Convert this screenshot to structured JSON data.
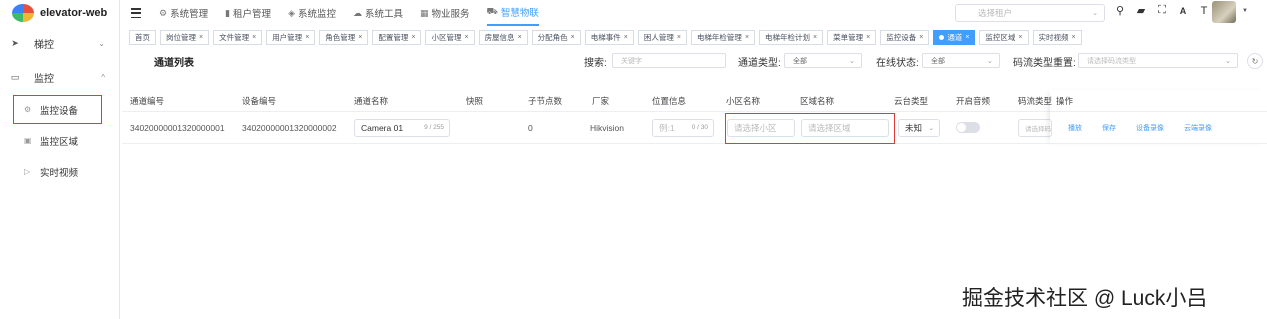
{
  "app": {
    "name": "elevator-web"
  },
  "sidebar": {
    "groups": [
      {
        "label": "梯控",
        "icon": "send-icon",
        "expanded": false
      },
      {
        "label": "监控",
        "icon": "camera-icon",
        "expanded": true,
        "items": [
          {
            "label": "监控设备",
            "icon": "device-icon",
            "active": true
          },
          {
            "label": "监控区域",
            "icon": "area-icon"
          },
          {
            "label": "实时视频",
            "icon": "video-icon"
          }
        ]
      }
    ]
  },
  "topnav": {
    "items": [
      {
        "label": "系统管理",
        "icon": "gear-icon"
      },
      {
        "label": "租户管理",
        "icon": "bar-chart-icon"
      },
      {
        "label": "系统监控",
        "icon": "shield-icon"
      },
      {
        "label": "系统工具",
        "icon": "cloud-icon"
      },
      {
        "label": "物业服务",
        "icon": "building-icon"
      },
      {
        "label": "智慧物联",
        "icon": "car-icon",
        "active": true
      }
    ],
    "tenant_placeholder": "选择租户",
    "tools": [
      "search-icon",
      "message-icon",
      "fullscreen-icon",
      "font-icon",
      "text-size-icon"
    ]
  },
  "tags": [
    {
      "label": "首页",
      "closable": false
    },
    {
      "label": "岗位管理",
      "closable": true
    },
    {
      "label": "文件管理",
      "closable": true
    },
    {
      "label": "用户管理",
      "closable": true
    },
    {
      "label": "角色管理",
      "closable": true
    },
    {
      "label": "配置管理",
      "closable": true
    },
    {
      "label": "小区管理",
      "closable": true
    },
    {
      "label": "房屋信息",
      "closable": true
    },
    {
      "label": "分配角色",
      "closable": true
    },
    {
      "label": "电梯事件",
      "closable": true
    },
    {
      "label": "困人管理",
      "closable": true
    },
    {
      "label": "电梯年检管理",
      "closable": true
    },
    {
      "label": "电梯年检计划",
      "closable": true
    },
    {
      "label": "菜单管理",
      "closable": true
    },
    {
      "label": "监控设备",
      "closable": true
    },
    {
      "label": "通道",
      "closable": true,
      "active": true
    },
    {
      "label": "监控区域",
      "closable": true
    },
    {
      "label": "实时视频",
      "closable": true
    }
  ],
  "page": {
    "title": "通道列表",
    "filters": {
      "search_label": "搜索:",
      "search_placeholder": "关键字",
      "channel_type_label": "通道类型:",
      "channel_type_value": "全部",
      "online_label": "在线状态:",
      "online_value": "全部",
      "stream_label": "码流类型重置:",
      "stream_placeholder": "请选择码流类型"
    }
  },
  "table": {
    "columns": [
      "通道编号",
      "设备编号",
      "通道名称",
      "快照",
      "子节点数",
      "厂家",
      "位置信息",
      "小区名称",
      "区域名称",
      "云台类型",
      "开启音频",
      "码流类型",
      "操作"
    ],
    "row": {
      "channel_id": "34020000001320000001",
      "device_id": "34020000001320000002",
      "channel_name": "Camera 01",
      "channel_name_count": "9 / 255",
      "children": "0",
      "vendor": "Hikvision",
      "location_placeholder": "例:1",
      "location_count": "0 / 30",
      "community_placeholder": "请选择小区",
      "area_placeholder": "请选择区域",
      "ptz_value": "未知",
      "stream_placeholder": "请选择码",
      "actions": [
        "播放",
        "保存",
        "设备录像",
        "云端录像"
      ]
    }
  },
  "watermark": "掘金技术社区 @ Luck小吕"
}
